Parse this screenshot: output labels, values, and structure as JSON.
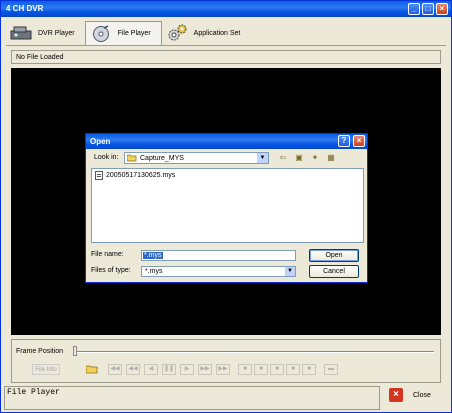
{
  "window": {
    "title": "4 CH DVR",
    "min_glyph": "_",
    "max_glyph": "□",
    "close_glyph": "×"
  },
  "tabs": [
    {
      "label": "DVR Player",
      "icon": "dvr-player-icon"
    },
    {
      "label": "File Player",
      "icon": "file-player-icon"
    },
    {
      "label": "Application Set",
      "icon": "gears-icon"
    }
  ],
  "status_top": "No File Loaded",
  "frame": {
    "label": "Frame Position",
    "file_info_label": "File Info",
    "position": 0
  },
  "status_bottom": "File Player",
  "close_label": "Close",
  "dialog": {
    "title": "Open",
    "help_glyph": "?",
    "close_glyph": "×",
    "look_in_label": "Look in:",
    "look_in_value": "Capture_MYS",
    "files": [
      "20050517130625.mys"
    ],
    "file_name_label": "File name:",
    "file_name_value": "*.mys",
    "files_of_type_label": "Files of type:",
    "files_of_type_value": "*.mys",
    "open_label": "Open",
    "cancel_label": "Cancel"
  },
  "colors": {
    "title_blue": "#0554e3",
    "screen_bg": "#000000",
    "close_red": "#d3361f"
  }
}
